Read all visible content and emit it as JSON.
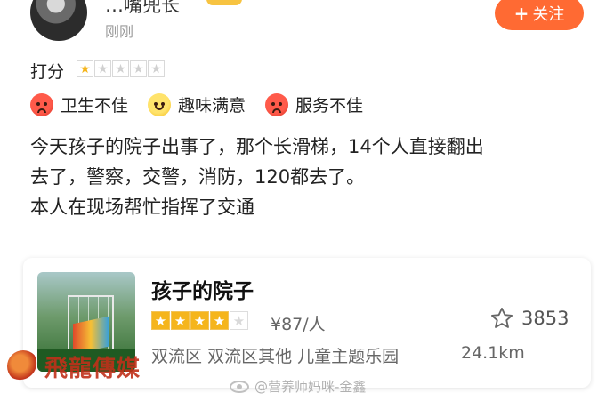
{
  "review_header": {
    "username": "…嘴兜长",
    "timestamp": "刚刚",
    "follow_button": {
      "icon": "plus-icon",
      "label": "关注"
    }
  },
  "rating": {
    "label": "打分",
    "score": 1,
    "max": 5
  },
  "tags": [
    {
      "icon": "angry-face-icon",
      "label": "卫生不佳"
    },
    {
      "icon": "smiley-face-icon",
      "label": "趣味满意"
    },
    {
      "icon": "angry-face-icon",
      "label": "服务不佳"
    }
  ],
  "review_text": {
    "line1": "今天孩子的院子出事了，那个长滑梯，14个人直接翻出",
    "line2": "去了，警察，交警，消防，120都去了。",
    "line3": "本人在现场帮忙指挥了交通"
  },
  "poi": {
    "name": "孩子的院子",
    "stars": 4,
    "stars_max": 5,
    "price": "¥87/人",
    "favorites": "3853",
    "district": "双流区",
    "area": "双流区其他",
    "category": "儿童主题乐园",
    "distance": "24.1km"
  },
  "watermarks": {
    "brand": "飛龍傳媒",
    "weibo": "@营养师妈咪-金鑫"
  },
  "colors": {
    "accent": "#ff6a33",
    "star": "#f5b51c"
  }
}
